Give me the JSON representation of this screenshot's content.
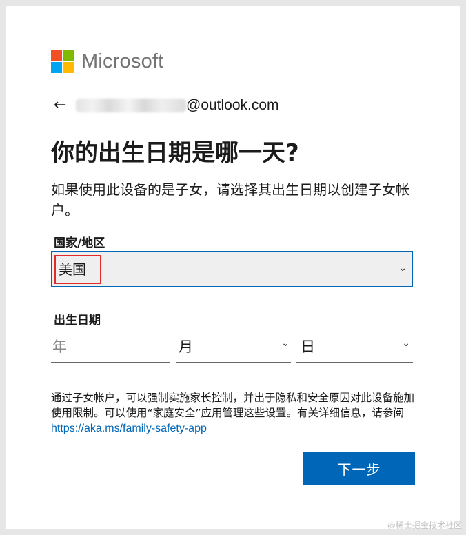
{
  "logo": {
    "text": "Microsoft",
    "colors": [
      "#f25022",
      "#7fba00",
      "#00a4ef",
      "#ffb900"
    ]
  },
  "account": {
    "back_icon": "arrow-left-icon",
    "email_suffix": "@outlook.com"
  },
  "title": "你的出生日期是哪一天?",
  "description": "如果使用此设备的是子女，请选择其出生日期以创建子女帐户。",
  "country": {
    "label": "国家/地区",
    "selected": "美国"
  },
  "birthdate": {
    "label": "出生日期",
    "year_placeholder": "年",
    "month_placeholder": "月",
    "day_placeholder": "日"
  },
  "notice": {
    "text": "通过子女帐户，可以强制实施家长控制，并出于隐私和安全原因对此设备施加使用限制。可以使用“家庭安全”应用管理这些设置。有关详细信息，请参阅",
    "link": "https://aka.ms/family-safety-app"
  },
  "next_button": "下一步",
  "watermark": "@稀土掘金技术社区",
  "colors": {
    "accent": "#0067b8",
    "highlight_box": "#e22a2a"
  }
}
